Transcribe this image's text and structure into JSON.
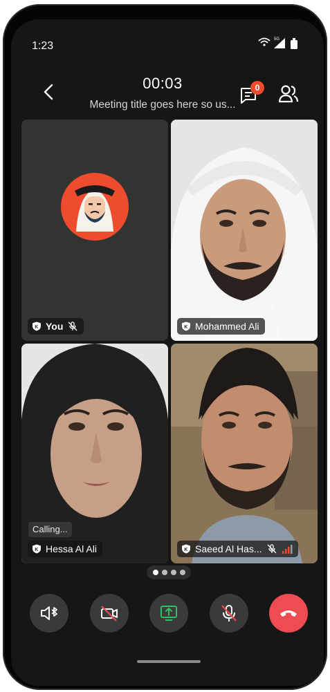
{
  "status": {
    "time": "1:23",
    "network": "5G"
  },
  "header": {
    "timer": "00:03",
    "meeting_title": "Meeting title goes here so us...",
    "chat_badge": "0"
  },
  "participants": [
    {
      "name": "You",
      "label": "You",
      "muted": true
    },
    {
      "name": "Mohammed Ali",
      "muted": false
    },
    {
      "name": "Hessa Al Ali",
      "status": "Calling...",
      "muted": false
    },
    {
      "name": "Saeed Al Has...",
      "muted": true
    }
  ],
  "pager": {
    "pages": 4,
    "active": 0
  },
  "controls": [
    "speaker-bluetooth",
    "camera-off",
    "share-screen",
    "mic-off",
    "end-call"
  ],
  "colors": {
    "accent_orange": "#ef4b2e",
    "end_call": "#ef4b52",
    "share_green": "#2fbf6a",
    "control_bg": "#3a3a3a",
    "tile_bg": "#323432"
  }
}
